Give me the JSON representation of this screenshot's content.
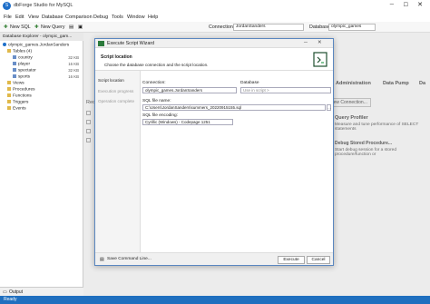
{
  "window": {
    "title": "dbForge Studio for MySQL",
    "logo": "S"
  },
  "menu": [
    "File",
    "Edit",
    "View",
    "Database",
    "Comparison",
    "Debug",
    "Tools",
    "Window",
    "Help"
  ],
  "toolbar": {
    "new_sql": "New SQL",
    "new_query": "New Query",
    "connection_label": "Connection:",
    "connection_value": "JordanSanders",
    "database_label": "Database:",
    "database_value": "olympic_games"
  },
  "explorer": {
    "title": "Database Explorer - olympic_gam...",
    "root": "olympic_games.JordanSanders",
    "tables_label": "Tables (4)",
    "tables": [
      {
        "name": "country",
        "size": "32 KB"
      },
      {
        "name": "player",
        "size": "16 KB"
      },
      {
        "name": "spectator",
        "size": "32 KB"
      },
      {
        "name": "sports",
        "size": "16 KB"
      }
    ],
    "folders": [
      "Views",
      "Procedures",
      "Functions",
      "Triggers",
      "Events"
    ]
  },
  "background": {
    "recent_label": "Rece",
    "tabs": [
      "Administration",
      "Data Pump",
      "Da"
    ],
    "new_connection": "New Connection...",
    "query_profiler_title": "Query Profiler",
    "query_profiler_desc": "Measure and tune performance of SELECT statements",
    "debug_title": "Debug Stored Procedure...",
    "debug_desc": "Start debug session for a stored procedure/function or"
  },
  "dialog": {
    "title": "Execute Script Wizard",
    "header_title": "Script location",
    "header_desc": "Choose the database connection and the script location.",
    "nav": [
      "Script location",
      "Execution progress",
      "Operation complete"
    ],
    "connection_label": "Connection:",
    "connection_value": "olympic_games.JordanSanders",
    "database_label": "Database",
    "database_placeholder": "Use in script >",
    "sql_file_label": "SQL file name:",
    "sql_file_value": "C:\\Users\\JordanSanders\\summers_20220915155.sql",
    "encoding_label": "SQL file encoding:",
    "encoding_value": "Cyrillic (Windows) - Codepage 1251",
    "save_cmd": "Save Command Line...",
    "execute": "Execute",
    "cancel": "Cancel"
  },
  "output_tab": "Output",
  "status": "Ready",
  "colors": {
    "accent": "#1f6fbf",
    "status_bar": "#1f6fbf"
  }
}
